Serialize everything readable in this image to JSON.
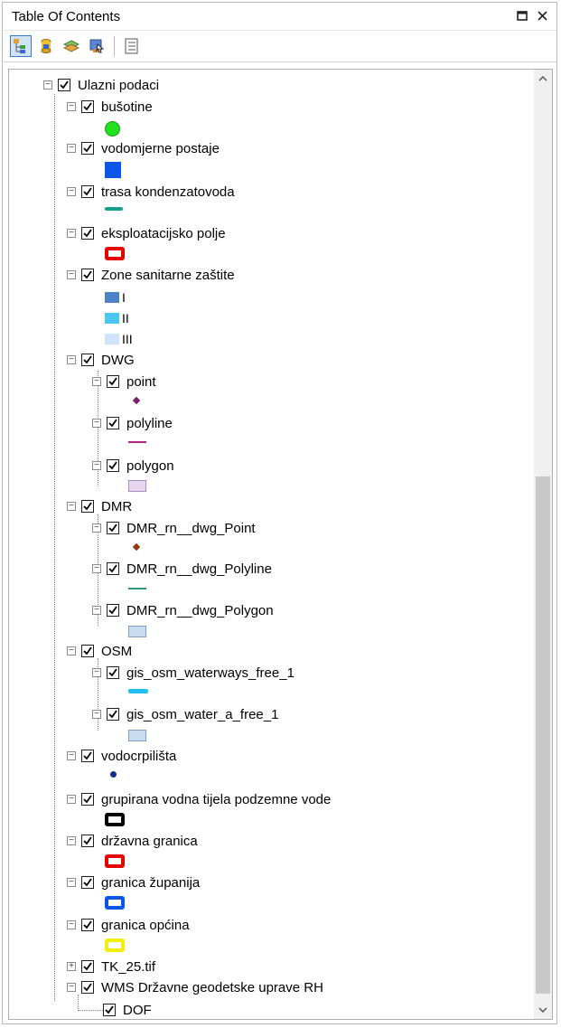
{
  "window": {
    "title": "Table Of Contents"
  },
  "toolbar": {
    "icons": [
      "list-by-drawing-order-icon",
      "list-by-source-icon",
      "list-by-visibility-icon",
      "list-by-selection-icon",
      "options-icon"
    ]
  },
  "tree": {
    "root": "Ulazni podaci",
    "bušotine": "bušotine",
    "vodomjerne": "vodomjerne postaje",
    "trasa": "trasa kondenzatovoda",
    "eksploatacijsko": "eksploatacijsko polje",
    "zone": "Zone sanitarne zaštite",
    "zone_I": "I",
    "zone_II": "II",
    "zone_III": "III",
    "dwg": "DWG",
    "dwg_point": "point",
    "dwg_polyline": "polyline",
    "dwg_polygon": "polygon",
    "dmr": "DMR",
    "dmr_point": "DMR_rn__dwg_Point",
    "dmr_polyline": "DMR_rn__dwg_Polyline",
    "dmr_polygon": "DMR_rn__dwg_Polygon",
    "osm": "OSM",
    "osm_waterways": "gis_osm_waterways_free_1",
    "osm_water": "gis_osm_water_a_free_1",
    "vodocrpilista": "vodocrpilišta",
    "grupirana": "grupirana vodna tijela podzemne vode",
    "drzavna": "državna granica",
    "zupanija": "granica županija",
    "opcina": "granica općina",
    "tk25": "TK_25.tif",
    "wms": "WMS Državne geodetske uprave RH",
    "dof": "DOF"
  },
  "colors": {
    "bušotine": "#22e11f",
    "vodomjerne": "#0a56e8",
    "trasa": "#13a18b",
    "eksploatacijsko": "#e60000",
    "zone_I": "#4f81c7",
    "zone_II": "#4ec7ee",
    "zone_III": "#cfe3fb",
    "dwg_point": "#7a1f66",
    "dwg_polyline": "#b3267a",
    "dwg_polygon": "#e6d6f0",
    "dmr_point": "#8b3a12",
    "dmr_polyline": "#2e9b75",
    "dmr_polygon": "#c9dcf2",
    "osm_waterways": "#1fc1f0",
    "osm_water": "#c9dcf2",
    "vodocrpilista": "#0e2d8f",
    "grupirana": "#000000",
    "drzavna": "#e60000",
    "zupanija": "#0a56e8",
    "opcina": "#f0f000"
  }
}
